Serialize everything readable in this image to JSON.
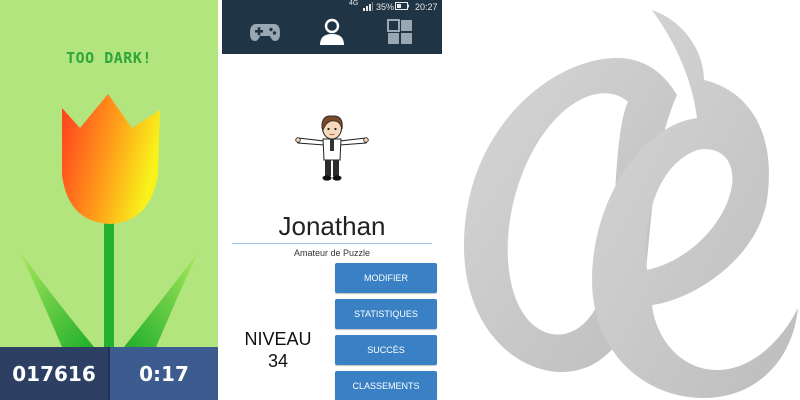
{
  "game": {
    "message": "TOO DARK!",
    "score": "017616",
    "timer": "0:17",
    "colors": {
      "background": "#b2e57e",
      "message": "#2da63a",
      "score_bg": "#2d3f63",
      "timer_bg": "#3c5b8f"
    }
  },
  "phone": {
    "status": {
      "network": "4G",
      "battery": "35%",
      "time": "20:27"
    },
    "nav": {
      "tabs": [
        "gamepad-icon",
        "profile-icon",
        "grid-icon"
      ],
      "active": "profile-icon"
    },
    "profile": {
      "name": "Jonathan",
      "title": "Amateur de Puzzle",
      "level_label": "NIVEAU",
      "level_value": "34"
    },
    "buttons": [
      {
        "label": "MODIFIER"
      },
      {
        "label": "STATISTIQUES"
      },
      {
        "label": "SUCCÈS"
      },
      {
        "label": "CLASSEMENTS"
      }
    ],
    "colors": {
      "nav": "#1f3445",
      "button": "#3a80c5"
    }
  },
  "logo": {
    "icon": "brand-logo-icon",
    "color": "#c8c8c8"
  }
}
